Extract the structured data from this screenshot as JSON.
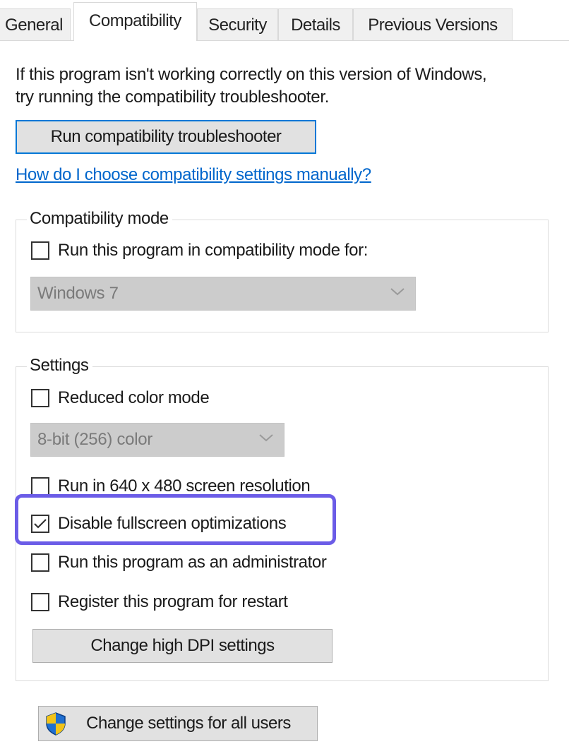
{
  "tabs": [
    {
      "label": "General"
    },
    {
      "label": "Compatibility",
      "active": true
    },
    {
      "label": "Security"
    },
    {
      "label": "Details"
    },
    {
      "label": "Previous Versions"
    }
  ],
  "intro": {
    "line1": "If this program isn't working correctly on this version of Windows,",
    "line2": "try running the compatibility troubleshooter."
  },
  "troubleshooter_button": "Run compatibility troubleshooter",
  "help_link": "How do I choose compatibility settings manually?",
  "compat_mode": {
    "legend": "Compatibility mode",
    "checkbox_label": "Run this program in compatibility mode for:",
    "checked": false,
    "os_selected": "Windows 7"
  },
  "settings": {
    "legend": "Settings",
    "reduced_color": {
      "label": "Reduced color mode",
      "checked": false
    },
    "color_selected": "8-bit (256) color",
    "res_640": {
      "label": "Run in 640 x 480 screen resolution",
      "checked": false
    },
    "disable_fso": {
      "label": "Disable fullscreen optimizations",
      "checked": true
    },
    "run_admin": {
      "label": "Run this program as an administrator",
      "checked": false
    },
    "register_restart": {
      "label": "Register this program for restart",
      "checked": false
    },
    "dpi_button": "Change high DPI settings"
  },
  "all_users_button": "Change settings for all users",
  "colors": {
    "accent": "#0078d7",
    "highlight": "#6b5ce7",
    "link": "#0066cc"
  }
}
